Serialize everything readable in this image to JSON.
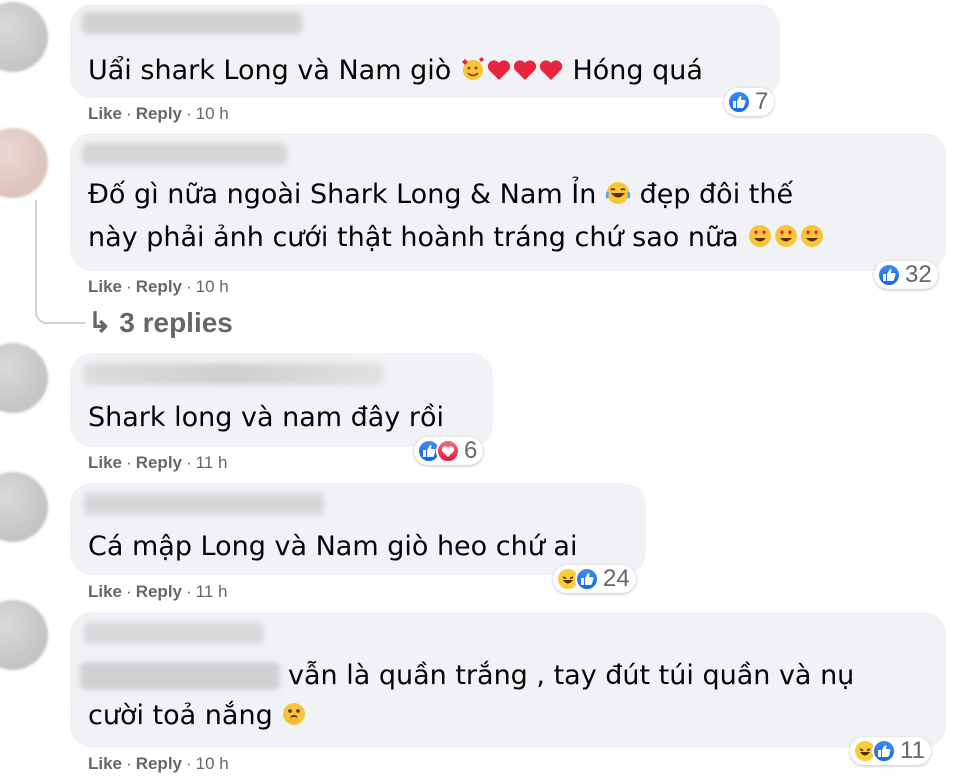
{
  "comments": [
    {
      "lines": [
        "Uẩi shark Long và Nam giò",
        "Hóng quá"
      ],
      "actions": {
        "like": "Like",
        "reply": "Reply",
        "time": "10 h"
      },
      "reaction_count": "7"
    },
    {
      "lines": [
        "Đố gì nữa ngoài Shark Long & Nam Ỉn",
        "đẹp đôi thế",
        "này phải ảnh cưới thật hoành tráng chứ sao nữa"
      ],
      "actions": {
        "like": "Like",
        "reply": "Reply",
        "time": "10 h"
      },
      "reaction_count": "32",
      "replies_label": "3 replies"
    },
    {
      "lines": [
        "Shark long và nam đây rồi"
      ],
      "actions": {
        "like": "Like",
        "reply": "Reply",
        "time": "11 h"
      },
      "reaction_count": "6"
    },
    {
      "lines": [
        "Cá mập Long và Nam giò heo chứ ai"
      ],
      "actions": {
        "like": "Like",
        "reply": "Reply",
        "time": "11 h"
      },
      "reaction_count": "24"
    },
    {
      "lines": [
        "vẫn là quần trắng , tay đút túi quần và nụ",
        "cười toả nắng"
      ],
      "actions": {
        "like": "Like",
        "reply": "Reply",
        "time": "10 h"
      },
      "reaction_count": "11"
    }
  ],
  "icons": {
    "reply_arrow": "↳",
    "like_color": "#1877f2",
    "love_color": "#f33e58",
    "haha_color": "#f7cd3b"
  }
}
